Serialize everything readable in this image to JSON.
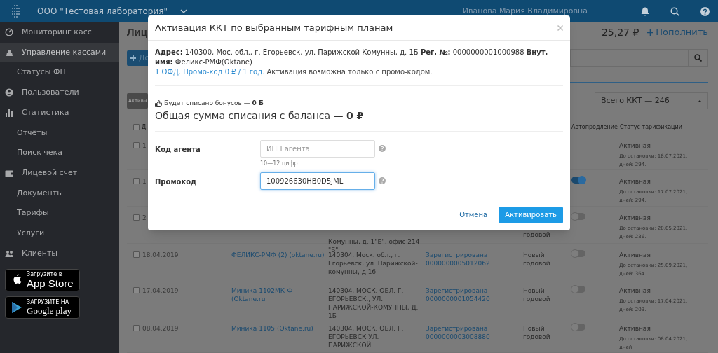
{
  "topbar": {
    "company": "ООО \"Тестовая лаборатория\"",
    "user": "Иванова Мария Владимировна"
  },
  "sidebar": {
    "items": [
      {
        "label": "Мониторинг касс",
        "selected": false
      },
      {
        "label": "Управление кассами",
        "selected": true,
        "children": [
          {
            "label": "Статусы ФН",
            "selected": false
          }
        ]
      },
      {
        "label": "Пользователи",
        "selected": false
      },
      {
        "label": "Статистика",
        "selected": false,
        "children": [
          {
            "label": "Отчёты",
            "selected": false
          },
          {
            "label": "Поиск чека",
            "selected": false
          }
        ]
      },
      {
        "label": "Лицевой счет",
        "selected": false,
        "children": [
          {
            "label": "Документы",
            "selected": false
          },
          {
            "label": "Тарифы",
            "selected": false
          },
          {
            "label": "Услуги",
            "selected": false
          }
        ]
      },
      {
        "label": "Клиенты",
        "selected": false
      }
    ],
    "store_badges": [
      {
        "kind": "apple",
        "caption": "Загрузите в",
        "name": "App Store"
      },
      {
        "kind": "google",
        "caption": "ЗАГРУЗИТЕ НА",
        "name": "Google play"
      }
    ]
  },
  "page": {
    "heading": "Лиц",
    "balance": "25,27 ₽",
    "topup": "Пополнить",
    "add_button": "До",
    "filter_button": "Активн",
    "total_dropdown": "Всего ККТ — 246",
    "table": {
      "header": {
        "checked": false,
        "date": "Д",
        "autorenew": "Автопродление",
        "status": "Статус тарификации"
      },
      "rows": [
        {
          "checked": false,
          "date": "1",
          "status": "Активная",
          "status_note": "До остановки: 18.07.2021, дней: 294."
        },
        {
          "checked": false,
          "date": "1",
          "autorenew": true,
          "status": "Активная",
          "status_note": "До остановки: 17.07.2021, дней: 294."
        },
        {
          "checked": false,
          "date": "2",
          "address": "Комунны, д. 1\"Б\", офис 214 \"Б\"",
          "tariff": "годовой",
          "autorenew": false,
          "status": "Активная",
          "status_note": "До остановки: 20.05.2021, дней: 236."
        },
        {
          "checked": false,
          "date": "18.04.2019",
          "name": "ФЕЛИКС-РМФ (2) (oktane.ru)",
          "address": "140304, Моск. обл., г. Егорьевск, ул. Парижской-комунны, д 1б",
          "registration": "Зарегистрирована",
          "reg_number": "0000000005012062",
          "tariff": "Новый годовой",
          "autorenew": false,
          "status": "Активная",
          "status_note": "До остановки: 25.09.2021, дней: 364."
        },
        {
          "checked": false,
          "date": "17.04.2019",
          "name": "Миника 1102МК-Ф (Oktane.ru",
          "address": "140304, МОСК. ОБЛ. Г. ЕГОРЬЕВСК., УЛ. ПАРИЖСКОЙ-КОМУННЫ, Д. 1Б",
          "registration": "Зарегистрирована",
          "reg_number": "0000000001054420",
          "tariff": "Новый годовой",
          "autorenew": false,
          "status": "Активная",
          "status_note": "До остановки: 17.04.2021, дней: 203."
        },
        {
          "checked": false,
          "date": "08.04.2019",
          "name": "Миника 1105 (Oktane.ru)",
          "address": "140304, МОСК. ОБЛ. Г. ЕГОРЬЕВСК УЛ. ПАРИЖСКОЙ",
          "registration": "Зарегистрирована",
          "reg_number": "0000000003008880",
          "tariff": "Новый годовой",
          "autorenew": false,
          "status": "Активная",
          "status_note": "До остановки: 08.04.2021, дней"
        }
      ]
    }
  },
  "modal": {
    "title": "Активация ККТ по выбранным тарифным планам",
    "details": "**Адрес:** 140300, Мос. обл., г. Егорьевск, ул. Парижской Комунны, д. 1Б **Рег. №:** 0000000001000988 **Внут. имя:** Феликс-РМФ(Oktane)",
    "tariff_link": "1 ОФД. Промо-код 0 ₽ / 1 год.",
    "tariff_note": "Активация возможна только с промо-кодом.",
    "bonus": "Будет списано бонусов — **0 Б**",
    "total": "Общая сумма списания с баланса — **0 ₽**",
    "fields": [
      {
        "label": "Код агента",
        "placeholder": "ИНН агента",
        "hint": "10—12 цифр.",
        "focused": false
      },
      {
        "label": "Промокод",
        "value": "100926630HB0D5JML",
        "focused": true
      }
    ],
    "cancel": "Отмена",
    "submit": "Активировать"
  }
}
